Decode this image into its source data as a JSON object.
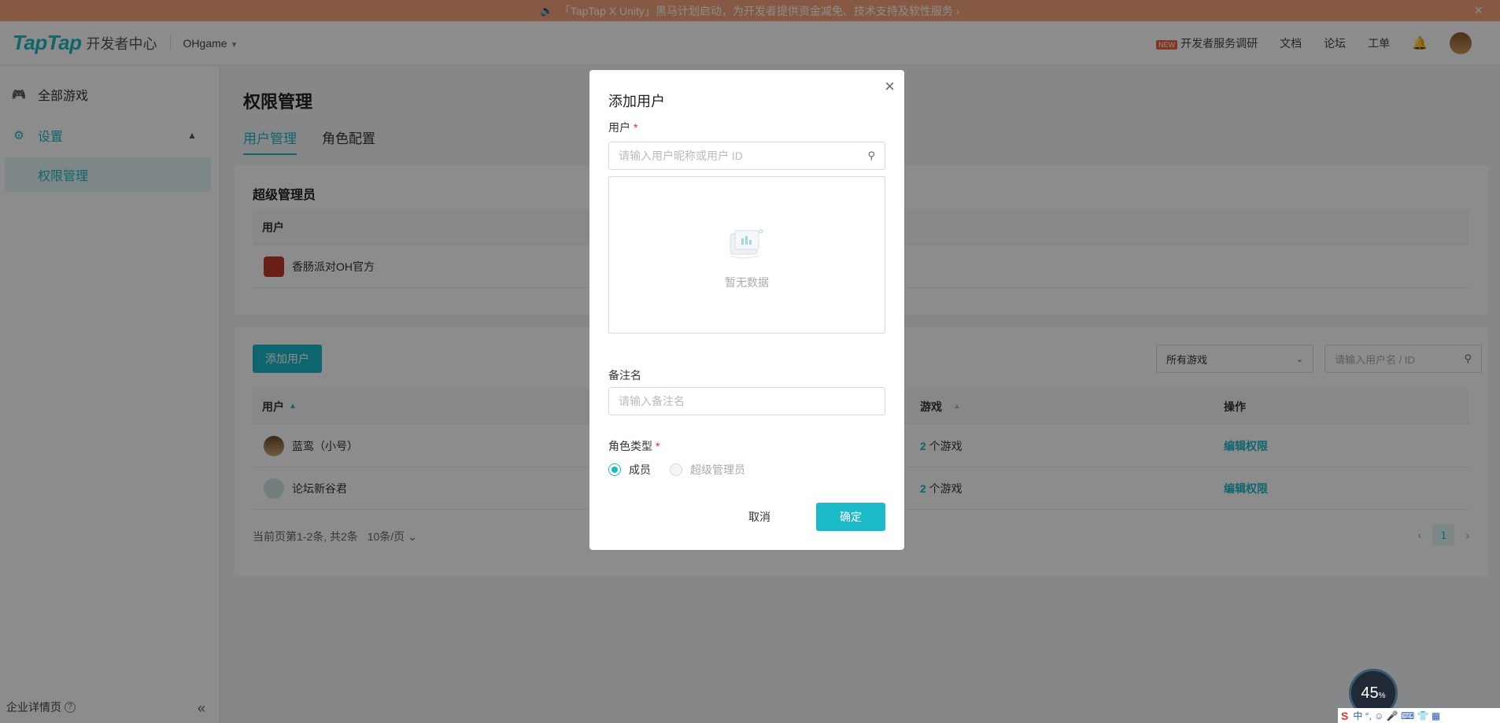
{
  "banner": {
    "text": "「TapTap X Unity」黑马计划启动，为开发者提供资金减免、技术支持及软性服务 ›",
    "close": "×"
  },
  "header": {
    "logo": "TapTap",
    "logo_sub": "开发者中心",
    "org": "OHgame",
    "new_badge": "NEW",
    "survey": "开发者服务调研",
    "docs": "文档",
    "forum": "论坛",
    "ticket": "工单"
  },
  "sidebar": {
    "all_games": "全部游戏",
    "settings": "设置",
    "permissions": "权限管理",
    "footer": "企业详情页"
  },
  "main": {
    "title": "权限管理",
    "tabs": [
      "用户管理",
      "角色配置"
    ],
    "super_admin": {
      "title": "超级管理员",
      "col_user": "用户",
      "row_user": "香肠派对OH官方"
    },
    "users": {
      "add_button": "添加用户",
      "game_filter": "所有游戏",
      "search_placeholder": "请输入用户名 / ID",
      "columns": {
        "user": "用户",
        "games": "游戏",
        "action": "操作"
      },
      "rows": [
        {
          "name": "蓝鸾（小号）",
          "games_prefix": "2",
          "games_suffix": " 个游戏",
          "action": "编辑权限"
        },
        {
          "name": "论坛新谷君",
          "games_prefix": "2",
          "games_suffix": " 个游戏",
          "action": "编辑权限"
        }
      ],
      "pager_info": "当前页第1-2条, 共2条",
      "page_size": "10条/页",
      "page": "1"
    }
  },
  "modal": {
    "title": "添加用户",
    "user_label": "用户",
    "required": "*",
    "user_placeholder": "请输入用户昵称或用户 ID",
    "empty_text": "暂无数据",
    "remark_label": "备注名",
    "remark_placeholder": "请输入备注名",
    "role_label": "角色类型",
    "role_member": "成员",
    "role_super": "超级管理员",
    "cancel": "取消",
    "confirm": "确定"
  },
  "widgets": {
    "gauge_value": "45",
    "gauge_unit": "%",
    "tray_text": "中 °, ☺ 🎤 ⌨ 👕 ▦"
  },
  "colors": {
    "accent": "#1cb9c8",
    "banner": "#f4a37d",
    "required": "#f5222d"
  }
}
